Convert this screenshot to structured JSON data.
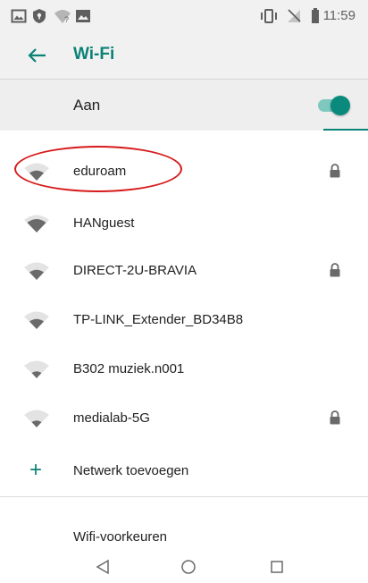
{
  "status_bar": {
    "time": "11:59",
    "icons": [
      "gallery-icon",
      "vpn-shield-icon",
      "wifi-question-icon",
      "image-icon",
      "vibrate-icon",
      "no-signal-icon",
      "battery-icon"
    ]
  },
  "app_bar": {
    "title": "Wi-Fi",
    "back_icon": "arrow-left-icon"
  },
  "master_switch": {
    "label": "Aan",
    "on": true
  },
  "networks": [
    {
      "ssid": "eduroam",
      "secured": true
    },
    {
      "ssid": "HANguest",
      "secured": false
    },
    {
      "ssid": "DIRECT-2U-BRAVIA",
      "secured": true
    },
    {
      "ssid": "TP-LINK_Extender_BD34B8",
      "secured": false
    },
    {
      "ssid": "B302 muziek.n001",
      "secured": false
    },
    {
      "ssid": "medialab-5G",
      "secured": true
    }
  ],
  "add_network": {
    "label": "Netwerk toevoegen"
  },
  "preferences": {
    "label": "Wifi-voorkeuren"
  },
  "nav_bar": {
    "icons": [
      "back-triangle-icon",
      "home-circle-icon",
      "recents-square-icon"
    ]
  },
  "colors": {
    "accent": "#0b8276",
    "highlight": "#d71a1a"
  }
}
